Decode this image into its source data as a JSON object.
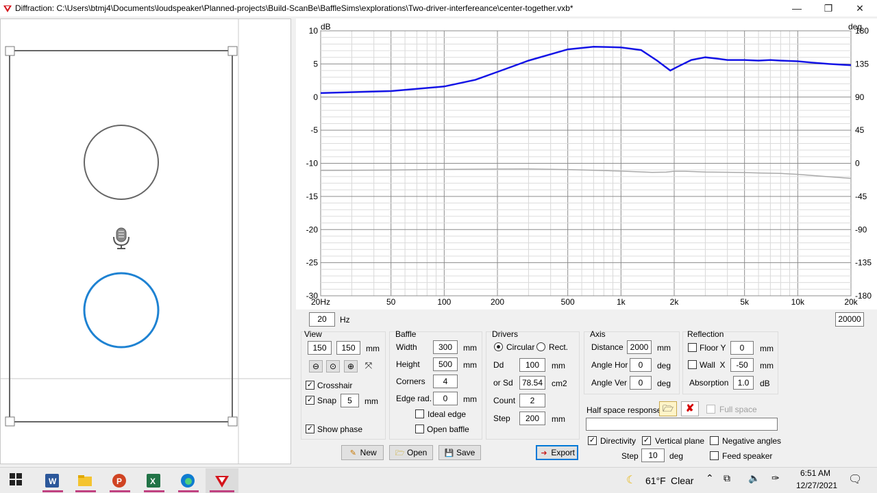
{
  "window": {
    "title": "Diffraction: C:\\Users\\btmj4\\Documents\\loudspeaker\\Planned-projects\\Build-ScanBe\\BaffleSims\\explorations\\Two-driver-interfereance\\center-together.vxb*",
    "min_glyph": "—",
    "max_glyph": "❐",
    "close_glyph": "✕"
  },
  "graph": {
    "left_unit": "dB",
    "right_unit": "deg",
    "y_ticks": [
      "10",
      "5",
      "0",
      "-5",
      "-10",
      "-15",
      "-20",
      "-25",
      "-30"
    ],
    "phase_ticks": [
      "180",
      "135",
      "90",
      "45",
      "0",
      "-45",
      "-90",
      "-135",
      "-180"
    ],
    "x_ticks": [
      "20Hz",
      "50",
      "100",
      "200",
      "500",
      "1k",
      "2k",
      "5k",
      "10k",
      "20k"
    ],
    "min_freq": "20",
    "hz_label": "Hz",
    "max_freq": "20000"
  },
  "chart_data": {
    "type": "line",
    "title": "",
    "xlabel": "",
    "ylabel": "dB",
    "y2label": "deg",
    "xscale": "log",
    "xlim": [
      20,
      20000
    ],
    "ylim": [
      -30,
      10
    ],
    "y2lim": [
      -180,
      180
    ],
    "grid": true,
    "series": [
      {
        "axis": "left",
        "color": "#1414e6",
        "x": [
          20,
          50,
          100,
          150,
          200,
          300,
          500,
          700,
          1000,
          1300,
          1600,
          1900,
          2100,
          2500,
          3000,
          3500,
          4000,
          5000,
          6000,
          7000,
          8000,
          10000,
          12000,
          15000,
          20000
        ],
        "y": [
          0.6,
          0.9,
          1.6,
          2.6,
          3.8,
          5.5,
          7.2,
          7.6,
          7.5,
          7.1,
          5.5,
          4.0,
          4.6,
          5.6,
          6.0,
          5.8,
          5.6,
          5.6,
          5.5,
          5.6,
          5.5,
          5.4,
          5.2,
          5.0,
          4.8
        ]
      },
      {
        "axis": "right",
        "color": "#aaaaaa",
        "x": [
          20,
          50,
          100,
          200,
          300,
          500,
          1000,
          1500,
          1800,
          2000,
          2300,
          3000,
          4000,
          5000,
          6000,
          8000,
          10000,
          15000,
          20000
        ],
        "y": [
          -9.7,
          -9.2,
          -8.3,
          -7.8,
          -7.6,
          -8.5,
          -10.6,
          -12.3,
          -12.0,
          -10.8,
          -10.8,
          -11.8,
          -12.2,
          -12.6,
          -13.1,
          -13.8,
          -15.0,
          -18.2,
          -20.5
        ]
      }
    ]
  },
  "view": {
    "group": "View",
    "w": "150",
    "h": "150",
    "unit": "mm",
    "crosshair": "Crosshair",
    "snap": "Snap",
    "snap_val": "5",
    "snap_unit": "mm",
    "show_phase": "Show phase"
  },
  "baffle": {
    "group": "Baffle",
    "width_lbl": "Width",
    "width": "300",
    "height_lbl": "Height",
    "height": "500",
    "corners_lbl": "Corners",
    "corners": "4",
    "edge_lbl": "Edge rad.",
    "edge": "0",
    "mm": "mm",
    "ideal_edge": "Ideal edge",
    "open_baffle": "Open baffle"
  },
  "drivers": {
    "group": "Drivers",
    "circular": "Circular",
    "rect": "Rect.",
    "dd_lbl": "Dd",
    "dd": "100",
    "mm": "mm",
    "sd_lbl": "or Sd",
    "sd": "78.54",
    "cm2": "cm2",
    "count_lbl": "Count",
    "count": "2",
    "step_lbl": "Step",
    "step": "200"
  },
  "axis": {
    "group": "Axis",
    "dist_lbl": "Distance",
    "dist": "2000",
    "mm": "mm",
    "ahor_lbl": "Angle Hor",
    "ahor": "0",
    "aver_lbl": "Angle Ver",
    "aver": "0",
    "deg": "deg"
  },
  "reflection": {
    "group": "Reflection",
    "floor_y": "Floor Y",
    "floor_val": "0",
    "wall_x": "Wall  X",
    "wall_val": "-50",
    "mm": "mm",
    "absorp_lbl": "Absorption",
    "absorp": "1.0",
    "db": "dB"
  },
  "halfspace": {
    "label": "Half space response",
    "full_space": "Full space"
  },
  "options": {
    "directivity": "Directivity",
    "vertical_plane": "Vertical plane",
    "negative_angles": "Negative angles",
    "step_lbl": "Step",
    "step": "10",
    "deg": "deg",
    "feed_speaker": "Feed speaker"
  },
  "buttons": {
    "new": "New",
    "open": "Open",
    "save": "Save",
    "export": "Export"
  },
  "taskbar": {
    "weather_temp": "61°F",
    "weather_desc": "Clear",
    "time": "6:51 AM",
    "date": "12/27/2021"
  }
}
